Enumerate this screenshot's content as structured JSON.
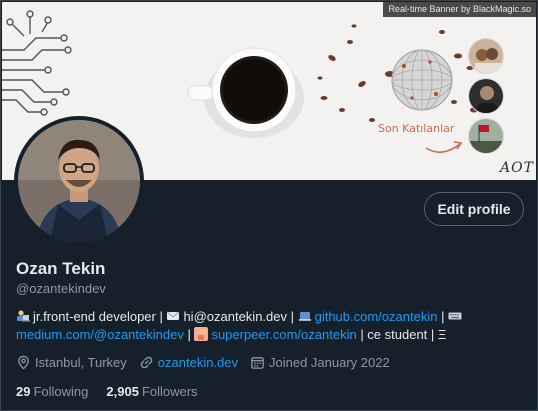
{
  "banner": {
    "credit": "Real-time Banner by BlackMagic.so",
    "followers_caption": "Son Katılanlar",
    "signature": "AOT",
    "colors": {
      "background": "#f4f2f0",
      "coffee": "#1a1412",
      "accent": "#c86a55"
    }
  },
  "profile": {
    "name": "Ozan Tekin",
    "handle": "@ozantekindev",
    "edit_button": "Edit profile",
    "bio": {
      "emoji_1": "laptop-person-icon",
      "part_1": "jr.front-end developer | ",
      "emoji_2": "envelope-icon",
      "part_2": "hi@ozantekin.dev | ",
      "emoji_3": "laptop-icon",
      "link_1": "github.com/ozantekin",
      "part_3": " | ",
      "emoji_4": "keyboard-icon",
      "link_2": "medium.com/@ozantekindev",
      "part_4": " | ",
      "emoji_5": "person-raising-hand-icon",
      "link_3": "superpeer.com/ozantekin",
      "part_5": " | ce student | Ξ"
    },
    "location": "Istanbul, Turkey",
    "website": "ozantekin.dev",
    "joined": "Joined January 2022",
    "following_count": "29",
    "following_label": "Following",
    "followers_count": "2,905",
    "followers_label": "Followers"
  },
  "theme": {
    "background": "#15202b",
    "text": "#e7e9ea",
    "secondary": "#8b98a5",
    "link": "#1d9bf0",
    "border": "#536471"
  }
}
